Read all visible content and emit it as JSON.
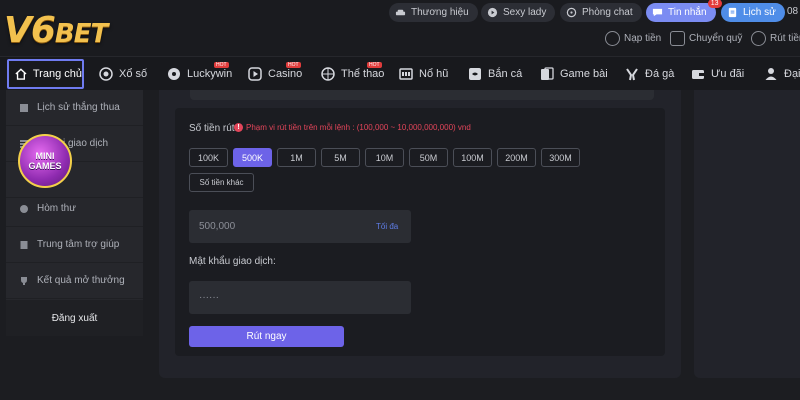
{
  "brand": {
    "logo_main": "V6",
    "logo_sub": "BET"
  },
  "top_links": {
    "brand": "Thương hiệu",
    "sexy_lady": "Sexy lady",
    "chat": "Phòng chat",
    "messages": "Tin nhắn",
    "messages_badge": "13",
    "history": "Lịch sử",
    "clip_text": "08"
  },
  "account_links": {
    "deposit": "Nạp tiền",
    "transfer": "Chuyển quỹ",
    "withdraw": "Rút tiền"
  },
  "nav": {
    "home": "Trang chủ",
    "lottery": "Xổ số",
    "luckywin": "Luckywin",
    "casino": "Casino",
    "sports": "Thể thao",
    "slots": "Nổ hũ",
    "fishing": "Bắn cá",
    "cards": "Game bài",
    "cockfight": "Đá gà",
    "promo": "Ưu đãi",
    "agent": "Đại",
    "hot_badge": "HOT"
  },
  "sidebar": {
    "items": [
      "Lịch sử thắng thua",
      "Lịch sử giao dịch",
      "",
      "Hòm thư",
      "Trung tâm trợ giúp",
      "Kết quả mở thưởng"
    ],
    "visible_partial": "i giao dịch",
    "logout": "Đăng xuất",
    "minigames_line1": "MINI",
    "minigames_line2": "GAMES"
  },
  "withdraw_form": {
    "amount_label": "Số tiền rút",
    "range_warning": "Phạm vi rút tiền trên mỗi lệnh : (100,000 ~ 10,000,000,000) vnd",
    "presets": [
      "100K",
      "500K",
      "1M",
      "5M",
      "10M",
      "50M",
      "100M",
      "200M",
      "300M"
    ],
    "active_preset": "500K",
    "other_amount": "Số tiền khác",
    "amount_value": "500,000",
    "max_link": "Tối đa",
    "password_label": "Mật khẩu giao dịch:",
    "password_value": "······",
    "submit": "Rút ngay"
  },
  "colors": {
    "accent": "#6d63e8",
    "gold": "#f2c14e",
    "warning": "#e3455a",
    "badge": "#e53b3b"
  }
}
